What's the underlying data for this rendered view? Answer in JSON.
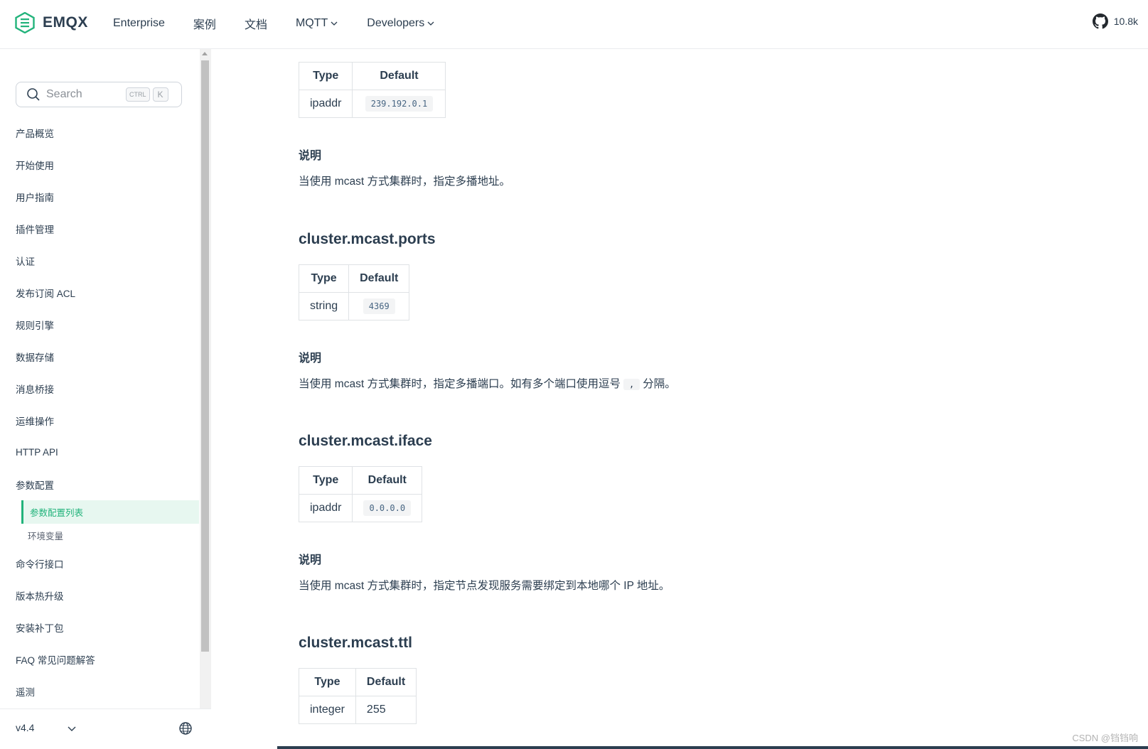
{
  "brand": {
    "name": "EMQX"
  },
  "nav": {
    "links": [
      {
        "label": "Enterprise",
        "has_dropdown": false
      },
      {
        "label": "案例",
        "has_dropdown": false
      },
      {
        "label": "文档",
        "has_dropdown": false
      },
      {
        "label": "MQTT",
        "has_dropdown": true
      },
      {
        "label": "Developers",
        "has_dropdown": true
      }
    ],
    "github_stars": "10.8k"
  },
  "search": {
    "placeholder": "Search",
    "shortcut_ctrl": "CTRL",
    "shortcut_key": "K"
  },
  "sidebar": {
    "items": [
      {
        "label": "产品概览"
      },
      {
        "label": "开始使用"
      },
      {
        "label": "用户指南"
      },
      {
        "label": "插件管理"
      },
      {
        "label": "认证"
      },
      {
        "label": "发布订阅 ACL"
      },
      {
        "label": "规则引擎"
      },
      {
        "label": "数据存储"
      },
      {
        "label": "消息桥接"
      },
      {
        "label": "运维操作"
      },
      {
        "label": "HTTP API"
      },
      {
        "label": "参数配置"
      }
    ],
    "subitems": [
      {
        "label": "参数配置列表",
        "active": true
      },
      {
        "label": "环境变量",
        "active": false
      }
    ],
    "items_after": [
      {
        "label": "命令行接口"
      },
      {
        "label": "版本热升级"
      },
      {
        "label": "安装补丁包"
      },
      {
        "label": "FAQ 常见问题解答"
      },
      {
        "label": "遥测"
      }
    ],
    "version": "v4.4"
  },
  "content": {
    "table_headers": {
      "type": "Type",
      "default": "Default"
    },
    "desc_label": "说明",
    "sections": [
      {
        "title": "",
        "type": "ipaddr",
        "default": "239.192.0.1",
        "default_is_code": true,
        "description": "当使用 mcast 方式集群时，指定多播地址。"
      },
      {
        "title": "cluster.mcast.ports",
        "type": "string",
        "default": "4369",
        "default_is_code": true,
        "description_before": "当使用 mcast 方式集群时，指定多播端口。如有多个端口使用逗号",
        "description_code": ",",
        "description_after": "分隔。"
      },
      {
        "title": "cluster.mcast.iface",
        "type": "ipaddr",
        "default": "0.0.0.0",
        "default_is_code": true,
        "description": "当使用 mcast 方式集群时，指定节点发现服务需要绑定到本地哪个 IP 地址。"
      },
      {
        "title": "cluster.mcast.ttl",
        "type": "integer",
        "default": "255",
        "default_is_code": false
      }
    ]
  },
  "watermark": "CSDN @铛铛响",
  "colors": {
    "accent": "#22b37b",
    "text": "#2c3e50",
    "active_bg": "#e7f7f0"
  }
}
